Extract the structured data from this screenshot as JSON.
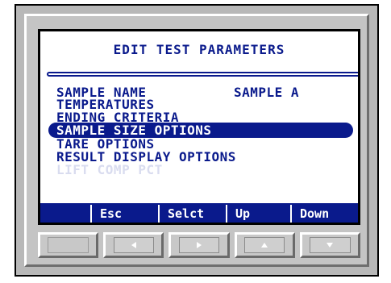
{
  "screen": {
    "title": "EDIT TEST PARAMETERS",
    "menu": [
      {
        "label": "SAMPLE NAME",
        "value": "SAMPLE A",
        "state": "normal"
      },
      {
        "label": "TEMPERATURES",
        "state": "normal"
      },
      {
        "label": "ENDING CRITERIA",
        "state": "normal"
      },
      {
        "label": "SAMPLE SIZE OPTIONS",
        "state": "selected"
      },
      {
        "label": "TARE OPTIONS",
        "state": "normal"
      },
      {
        "label": "RESULT DISPLAY OPTIONS",
        "state": "normal"
      },
      {
        "label": "LIFT COMP PCT",
        "state": "faded"
      }
    ],
    "softkeys": [
      "",
      "Esc",
      "Selct",
      "Up",
      "Down"
    ]
  },
  "keypad": {
    "buttons": [
      {
        "name": "blank-key",
        "icon": ""
      },
      {
        "name": "left-key",
        "icon": "arrow-left-icon"
      },
      {
        "name": "right-key",
        "icon": "arrow-right-icon"
      },
      {
        "name": "up-key",
        "icon": "arrow-up-icon"
      },
      {
        "name": "down-key",
        "icon": "arrow-down-icon"
      }
    ]
  },
  "colors": {
    "accent": "#0a1a8c",
    "device_body": "#b8b8b8",
    "screen_bg": "#ffffff"
  }
}
